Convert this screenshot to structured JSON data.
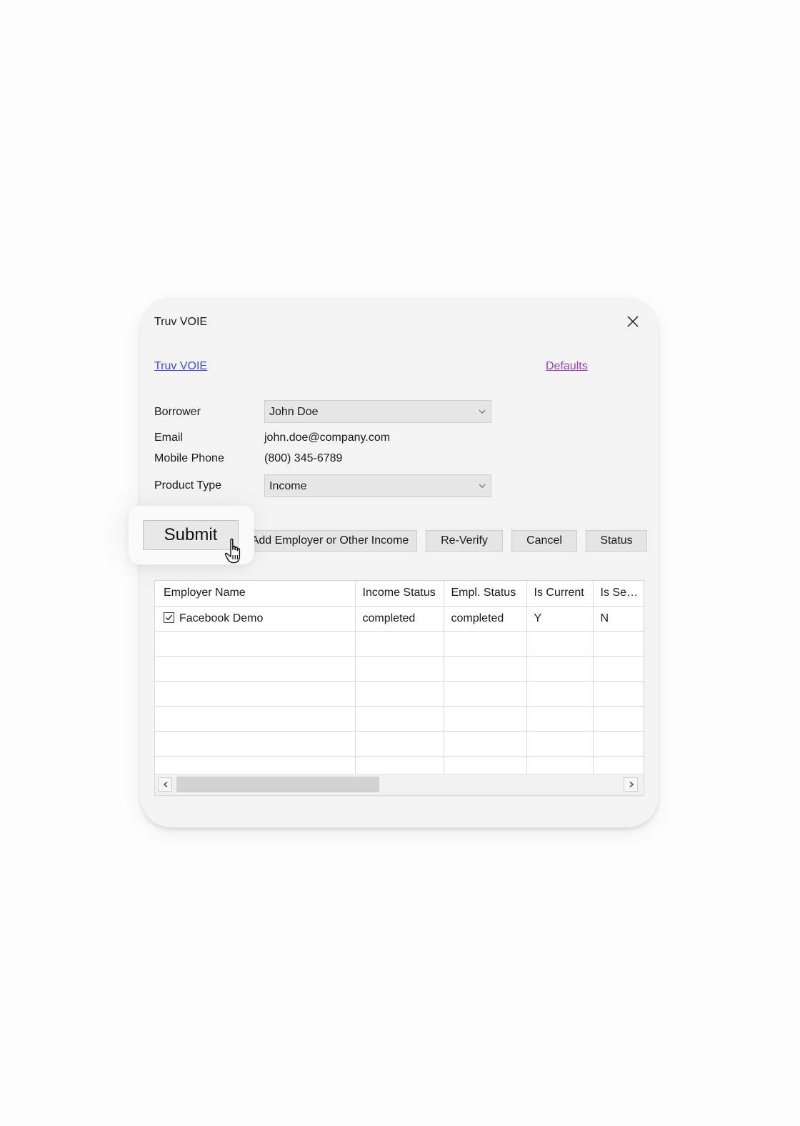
{
  "dialog": {
    "title": "Truv VOIE",
    "link_main": "Truv VOIE",
    "link_defaults": "Defaults"
  },
  "form": {
    "borrower": {
      "label": "Borrower",
      "value": "John Doe"
    },
    "email": {
      "label": "Email",
      "value": "john.doe@company.com"
    },
    "mobile_phone": {
      "label": "Mobile Phone",
      "value": "(800) 345-6789"
    },
    "product_type": {
      "label": "Product Type",
      "value": "Income"
    }
  },
  "actions": {
    "submit": "Submit",
    "add_employer": "Add Employer or Other Income",
    "reverify": "Re-Verify",
    "cancel": "Cancel",
    "status": "Status"
  },
  "table": {
    "columns": [
      "Employer Name",
      "Income Status",
      "Empl. Status",
      "Is Current",
      "Is Se…"
    ],
    "rows": [
      {
        "employer": "Facebook Demo",
        "checked": true,
        "income_status": "completed",
        "empl_status": "completed",
        "is_current": "Y",
        "is_se": "N"
      }
    ]
  },
  "icons": {
    "close": "close-icon",
    "dropdown": "chevron-down-icon",
    "checkbox": "checkbox-checked-icon",
    "scroll_left": "chevron-left-icon",
    "scroll_right": "chevron-right-icon",
    "cursor": "hand-pointer-icon"
  },
  "colors": {
    "dialog_bg": "#f3f3f3",
    "link_primary": "#4a4ad0",
    "link_visited": "#8a4aa6",
    "button_bg": "#e4e4e4"
  }
}
